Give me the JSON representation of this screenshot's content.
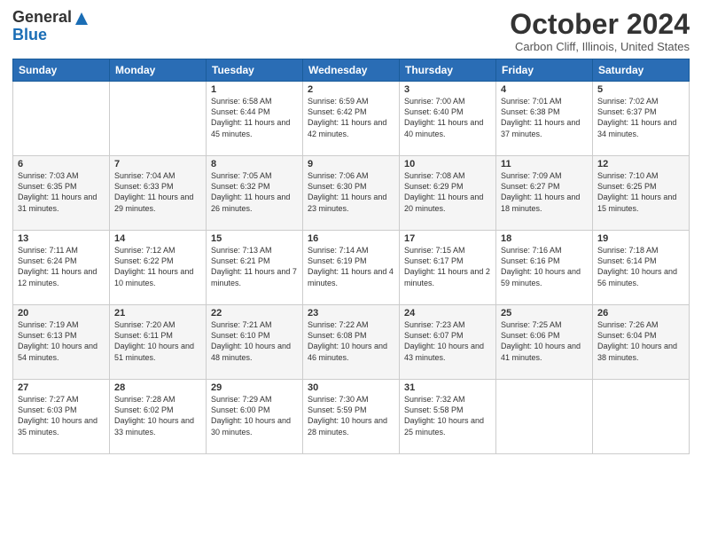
{
  "header": {
    "logo_general": "General",
    "logo_blue": "Blue",
    "month_title": "October 2024",
    "location": "Carbon Cliff, Illinois, United States"
  },
  "weekdays": [
    "Sunday",
    "Monday",
    "Tuesday",
    "Wednesday",
    "Thursday",
    "Friday",
    "Saturday"
  ],
  "weeks": [
    [
      {
        "day": "",
        "info": ""
      },
      {
        "day": "",
        "info": ""
      },
      {
        "day": "1",
        "info": "Sunrise: 6:58 AM\nSunset: 6:44 PM\nDaylight: 11 hours and 45 minutes."
      },
      {
        "day": "2",
        "info": "Sunrise: 6:59 AM\nSunset: 6:42 PM\nDaylight: 11 hours and 42 minutes."
      },
      {
        "day": "3",
        "info": "Sunrise: 7:00 AM\nSunset: 6:40 PM\nDaylight: 11 hours and 40 minutes."
      },
      {
        "day": "4",
        "info": "Sunrise: 7:01 AM\nSunset: 6:38 PM\nDaylight: 11 hours and 37 minutes."
      },
      {
        "day": "5",
        "info": "Sunrise: 7:02 AM\nSunset: 6:37 PM\nDaylight: 11 hours and 34 minutes."
      }
    ],
    [
      {
        "day": "6",
        "info": "Sunrise: 7:03 AM\nSunset: 6:35 PM\nDaylight: 11 hours and 31 minutes."
      },
      {
        "day": "7",
        "info": "Sunrise: 7:04 AM\nSunset: 6:33 PM\nDaylight: 11 hours and 29 minutes."
      },
      {
        "day": "8",
        "info": "Sunrise: 7:05 AM\nSunset: 6:32 PM\nDaylight: 11 hours and 26 minutes."
      },
      {
        "day": "9",
        "info": "Sunrise: 7:06 AM\nSunset: 6:30 PM\nDaylight: 11 hours and 23 minutes."
      },
      {
        "day": "10",
        "info": "Sunrise: 7:08 AM\nSunset: 6:29 PM\nDaylight: 11 hours and 20 minutes."
      },
      {
        "day": "11",
        "info": "Sunrise: 7:09 AM\nSunset: 6:27 PM\nDaylight: 11 hours and 18 minutes."
      },
      {
        "day": "12",
        "info": "Sunrise: 7:10 AM\nSunset: 6:25 PM\nDaylight: 11 hours and 15 minutes."
      }
    ],
    [
      {
        "day": "13",
        "info": "Sunrise: 7:11 AM\nSunset: 6:24 PM\nDaylight: 11 hours and 12 minutes."
      },
      {
        "day": "14",
        "info": "Sunrise: 7:12 AM\nSunset: 6:22 PM\nDaylight: 11 hours and 10 minutes."
      },
      {
        "day": "15",
        "info": "Sunrise: 7:13 AM\nSunset: 6:21 PM\nDaylight: 11 hours and 7 minutes."
      },
      {
        "day": "16",
        "info": "Sunrise: 7:14 AM\nSunset: 6:19 PM\nDaylight: 11 hours and 4 minutes."
      },
      {
        "day": "17",
        "info": "Sunrise: 7:15 AM\nSunset: 6:17 PM\nDaylight: 11 hours and 2 minutes."
      },
      {
        "day": "18",
        "info": "Sunrise: 7:16 AM\nSunset: 6:16 PM\nDaylight: 10 hours and 59 minutes."
      },
      {
        "day": "19",
        "info": "Sunrise: 7:18 AM\nSunset: 6:14 PM\nDaylight: 10 hours and 56 minutes."
      }
    ],
    [
      {
        "day": "20",
        "info": "Sunrise: 7:19 AM\nSunset: 6:13 PM\nDaylight: 10 hours and 54 minutes."
      },
      {
        "day": "21",
        "info": "Sunrise: 7:20 AM\nSunset: 6:11 PM\nDaylight: 10 hours and 51 minutes."
      },
      {
        "day": "22",
        "info": "Sunrise: 7:21 AM\nSunset: 6:10 PM\nDaylight: 10 hours and 48 minutes."
      },
      {
        "day": "23",
        "info": "Sunrise: 7:22 AM\nSunset: 6:08 PM\nDaylight: 10 hours and 46 minutes."
      },
      {
        "day": "24",
        "info": "Sunrise: 7:23 AM\nSunset: 6:07 PM\nDaylight: 10 hours and 43 minutes."
      },
      {
        "day": "25",
        "info": "Sunrise: 7:25 AM\nSunset: 6:06 PM\nDaylight: 10 hours and 41 minutes."
      },
      {
        "day": "26",
        "info": "Sunrise: 7:26 AM\nSunset: 6:04 PM\nDaylight: 10 hours and 38 minutes."
      }
    ],
    [
      {
        "day": "27",
        "info": "Sunrise: 7:27 AM\nSunset: 6:03 PM\nDaylight: 10 hours and 35 minutes."
      },
      {
        "day": "28",
        "info": "Sunrise: 7:28 AM\nSunset: 6:02 PM\nDaylight: 10 hours and 33 minutes."
      },
      {
        "day": "29",
        "info": "Sunrise: 7:29 AM\nSunset: 6:00 PM\nDaylight: 10 hours and 30 minutes."
      },
      {
        "day": "30",
        "info": "Sunrise: 7:30 AM\nSunset: 5:59 PM\nDaylight: 10 hours and 28 minutes."
      },
      {
        "day": "31",
        "info": "Sunrise: 7:32 AM\nSunset: 5:58 PM\nDaylight: 10 hours and 25 minutes."
      },
      {
        "day": "",
        "info": ""
      },
      {
        "day": "",
        "info": ""
      }
    ]
  ]
}
